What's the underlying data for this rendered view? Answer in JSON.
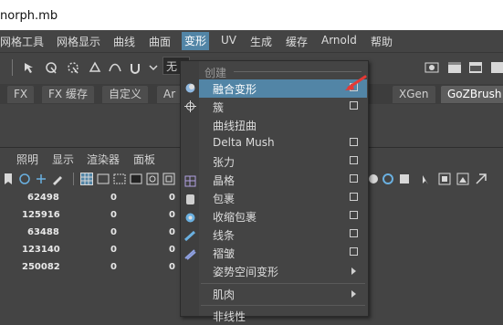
{
  "window": {
    "title": "norph.mb"
  },
  "menubar": {
    "items": [
      "网格工具",
      "网格显示",
      "曲线",
      "曲面",
      "变形",
      "UV",
      "生成",
      "缓存",
      "Arnold",
      "帮助"
    ],
    "active": "变形"
  },
  "toolbar": {
    "dropdown_value": "无"
  },
  "shelf_tabs": [
    "FX",
    "FX 缓存",
    "自定义",
    "Ar",
    "XGen",
    "GoZBrush"
  ],
  "panel_menu": [
    "照明",
    "显示",
    "渲染器",
    "面板"
  ],
  "data_rows": [
    {
      "v1": "62498",
      "v2": "0",
      "v3": "0"
    },
    {
      "v1": "125916",
      "v2": "0",
      "v3": "0"
    },
    {
      "v1": "63488",
      "v2": "0",
      "v3": "0"
    },
    {
      "v1": "123140",
      "v2": "0",
      "v3": "0"
    },
    {
      "v1": "250082",
      "v2": "0",
      "v3": "0"
    }
  ],
  "deform_menu": {
    "section": "创建",
    "items": [
      {
        "label": "融合变形",
        "option": true,
        "highlight": true
      },
      {
        "label": "簇",
        "option": true
      },
      {
        "label": "曲线扭曲",
        "option": false
      },
      {
        "label": "Delta Mush",
        "option": true
      },
      {
        "label": "张力",
        "option": true
      },
      {
        "label": "晶格",
        "option": true
      },
      {
        "label": "包裹",
        "option": true
      },
      {
        "label": "收缩包裹",
        "option": true
      },
      {
        "label": "线条",
        "option": true
      },
      {
        "label": "褶皱",
        "option": true
      },
      {
        "label": "姿势空间变形",
        "submenu": true
      },
      {
        "label": "肌肉",
        "submenu": true
      },
      {
        "label": "非线性",
        "submenu": false
      }
    ]
  },
  "colors": {
    "highlight": "#5285a6",
    "background": "#444444",
    "annotation_arrow": "#e53935"
  }
}
